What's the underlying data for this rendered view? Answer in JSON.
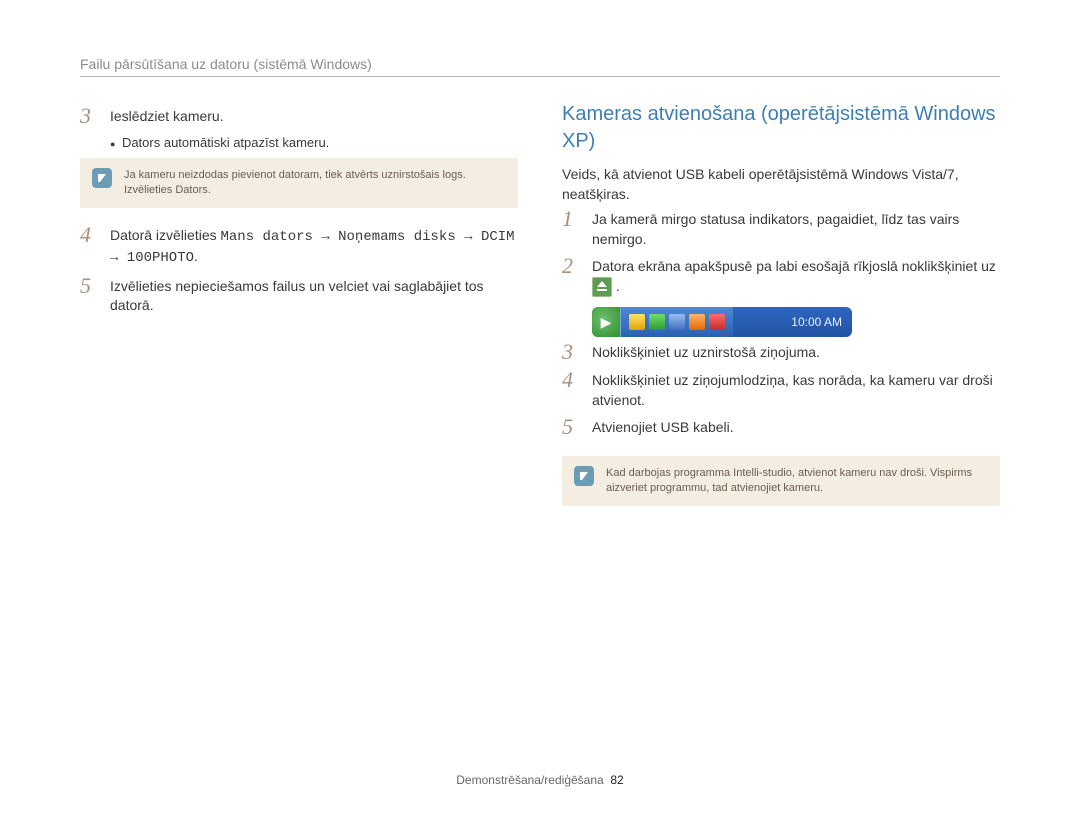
{
  "header": {
    "title": "Failu pārsūtīšana uz datoru (sistēmā Windows)"
  },
  "left": {
    "step3": {
      "title": "Ieslēdziet kameru.",
      "bullet": "Dators automātiski atpazīst kameru.",
      "note": "Ja kameru neizdodas pievienot datoram, tiek atvērts uznirstošais logs. Izvēlieties Dators."
    },
    "step4": {
      "prefix": "Datorā izvēlieties ",
      "path": "Mans dators → Noņemams disks → DCIM → 100PHOTO",
      "suffix": "."
    },
    "step5": {
      "text": "Izvēlieties nepieciešamos failus un velciet vai saglabājiet tos datorā."
    }
  },
  "right": {
    "heading": "Kameras atvienošana (operētājsistēmā Windows XP)",
    "intro": "Veids, kā atvienot USB kabeli operētājsistēmā Windows Vista/7, neatšķiras.",
    "step1": "Ja kamerā mirgo statusa indikators, pagaidiet, līdz tas vairs nemirgo.",
    "step2a": "Datora ekrāna apakšpusē pa labi esošajā rīkjoslā noklikšķiniet uz ",
    "step2b": ".",
    "taskbar_clock": "10:00 AM",
    "step3": "Noklikšķiniet uz uznirstošā ziņojuma.",
    "step4": "Noklikšķiniet uz ziņojumlodziņa, kas norāda, ka kameru var droši atvienot.",
    "step5": "Atvienojiet USB kabeli.",
    "note": "Kad darbojas programma Intelli-studio, atvienot kameru nav droši. Vispirms aizveriet programmu, tad atvienojiet kameru."
  },
  "footer": {
    "section": "Demonstrēšana/rediģēšana",
    "page": "82"
  }
}
